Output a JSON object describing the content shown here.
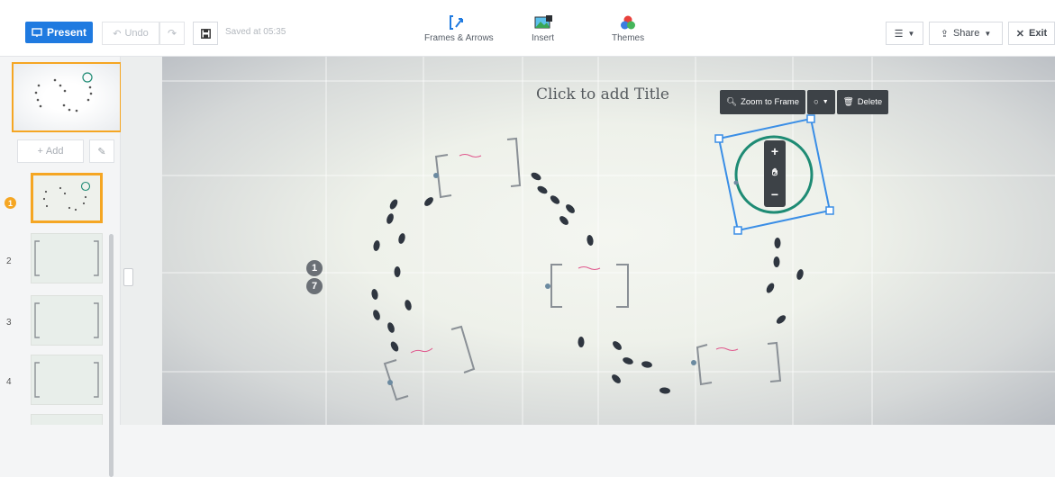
{
  "toolbar": {
    "present_label": "Present",
    "undo_label": "Undo",
    "saved_text": "Saved at 05:35",
    "tools": [
      {
        "label": "Frames & Arrows",
        "icon": "frames-arrows-icon"
      },
      {
        "label": "Insert",
        "icon": "insert-image-icon"
      },
      {
        "label": "Themes",
        "icon": "themes-icon"
      }
    ],
    "share_label": "Share",
    "exit_label": "Exit"
  },
  "sidebar": {
    "add_label": "Add",
    "active_badge": "1",
    "thumbnails": [
      {
        "number": "1",
        "active": true
      },
      {
        "number": "2",
        "active": false
      },
      {
        "number": "3",
        "active": false
      },
      {
        "number": "4",
        "active": false
      }
    ]
  },
  "canvas": {
    "title_placeholder": "Click to add Title",
    "zoom_toolbar": {
      "zoom_label": "Zoom to Frame",
      "delete_label": "Delete"
    },
    "path_badges": [
      "1",
      "7"
    ]
  },
  "colors": {
    "accent": "#1f7ae0",
    "active_slide": "#f5a623",
    "selection": "#3a8ee6",
    "circle_frame": "#1e8b74",
    "footprint": "#2f3640"
  }
}
